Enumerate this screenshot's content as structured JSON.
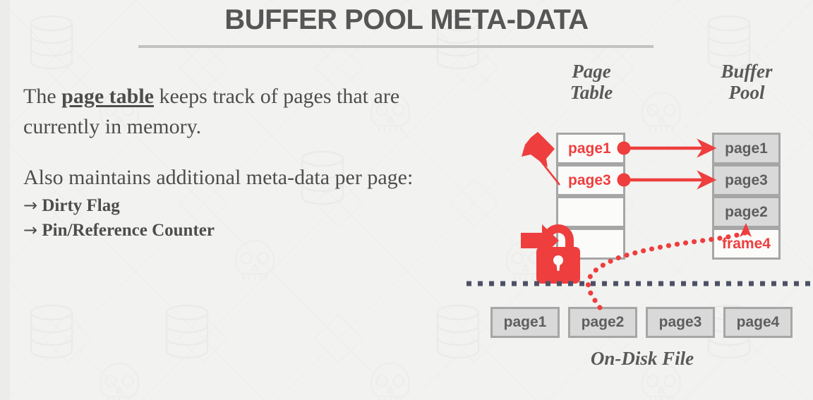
{
  "slide": {
    "title": "BUFFER POOL META-DATA",
    "background_color": "#f2f2f0",
    "title_color": "#565656",
    "accent_red": "#ee3e3e",
    "cell_gray": "#d9d9d9",
    "border_gray": "#a6a6a6"
  },
  "body": {
    "paragraph1_pre": "The ",
    "paragraph1_keyword": "page table",
    "paragraph1_post": " keeps track of pages that are currently in memory.",
    "paragraph2": "Also maintains additional meta-data per page:",
    "bullets": [
      {
        "arrow": "→",
        "text": "Dirty Flag"
      },
      {
        "arrow": "→",
        "text": "Pin/Reference Counter"
      }
    ]
  },
  "diagram": {
    "page_table_heading": "Page\nTable",
    "buffer_pool_heading": "Buffer\nPool",
    "on_disk_label": "On-Disk File",
    "page_table_cells": [
      {
        "label": "page1",
        "has_pointer": true
      },
      {
        "label": "page3",
        "has_pointer": true
      },
      {
        "label": "",
        "has_pointer": false
      },
      {
        "label": "",
        "has_pointer": false
      }
    ],
    "buffer_pool_cells": [
      {
        "label": "page1",
        "state": "filled"
      },
      {
        "label": "page3",
        "state": "filled"
      },
      {
        "label": "page2",
        "state": "filled"
      },
      {
        "label": "frame4",
        "state": "empty"
      }
    ],
    "on_disk_pages": [
      "page1",
      "page2",
      "page3",
      "page4"
    ],
    "icons": {
      "pin": "pushpin-icon",
      "lock": "padlock-icon",
      "lock_arrow": "right-arrow-icon"
    }
  }
}
